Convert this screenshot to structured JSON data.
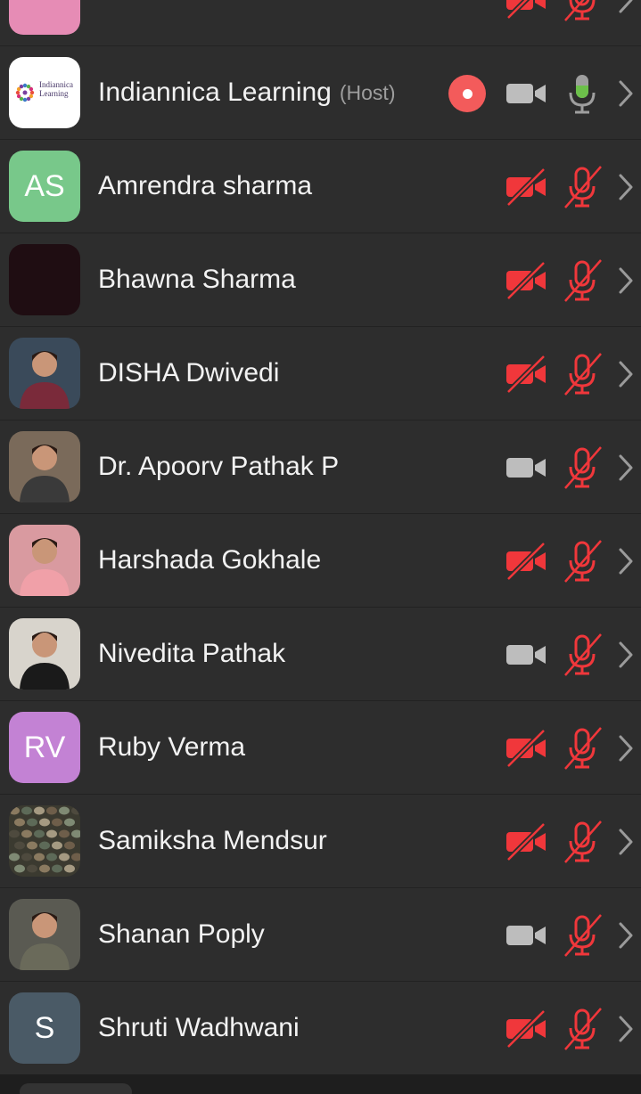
{
  "participants": [
    {
      "name": "",
      "initials": "",
      "avatar_type": "color",
      "avatar_color": "#e68cb5",
      "host_label": "",
      "recording": false,
      "video": "off",
      "audio": "muted"
    },
    {
      "name": "Indiannica Learning",
      "initials": "",
      "avatar_type": "logo",
      "logo_text": "Indiannica Learning",
      "host_label": "(Host)",
      "recording": true,
      "video": "on",
      "audio": "active"
    },
    {
      "name": "Amrendra sharma",
      "initials": "AS",
      "avatar_type": "initials",
      "avatar_color": "#78c88a",
      "host_label": "",
      "recording": false,
      "video": "off",
      "audio": "muted"
    },
    {
      "name": "Bhawna Sharma",
      "initials": "",
      "avatar_type": "color",
      "avatar_color": "#1f0d12",
      "host_label": "",
      "recording": false,
      "video": "off",
      "audio": "muted"
    },
    {
      "name": "DISHA Dwivedi",
      "initials": "",
      "avatar_type": "photo",
      "host_label": "",
      "recording": false,
      "video": "off",
      "audio": "muted"
    },
    {
      "name": "Dr. Apoorv Pathak P",
      "initials": "",
      "avatar_type": "photo",
      "host_label": "",
      "recording": false,
      "video": "on",
      "audio": "muted"
    },
    {
      "name": "Harshada Gokhale",
      "initials": "",
      "avatar_type": "photo",
      "host_label": "",
      "recording": false,
      "video": "off",
      "audio": "muted"
    },
    {
      "name": "Nivedita Pathak",
      "initials": "",
      "avatar_type": "photo",
      "host_label": "",
      "recording": false,
      "video": "on",
      "audio": "muted"
    },
    {
      "name": "Ruby Verma",
      "initials": "RV",
      "avatar_type": "initials",
      "avatar_color": "#c382d4",
      "host_label": "",
      "recording": false,
      "video": "off",
      "audio": "muted"
    },
    {
      "name": "Samiksha Mendsur",
      "initials": "",
      "avatar_type": "photo",
      "host_label": "",
      "recording": false,
      "video": "off",
      "audio": "muted"
    },
    {
      "name": "Shanan Poply",
      "initials": "",
      "avatar_type": "photo",
      "host_label": "",
      "recording": false,
      "video": "on",
      "audio": "muted"
    },
    {
      "name": "Shruti Wadhwani",
      "initials": "S",
      "avatar_type": "initials",
      "avatar_color": "#4a5a66",
      "host_label": "",
      "recording": false,
      "video": "off",
      "audio": "muted"
    }
  ],
  "icons": {
    "record": "record-icon",
    "video_on": "video-camera-icon",
    "video_off": "video-off-icon",
    "mic_active": "microphone-active-icon",
    "mic_muted": "microphone-muted-icon",
    "chevron": "chevron-right-icon"
  },
  "colors": {
    "background": "#2d2d2d",
    "text": "#f2f2f2",
    "muted_red": "#f0373b",
    "mic_active_green": "#6cc04a",
    "icon_gray": "#bdbdbd",
    "record_red": "#f35b5b",
    "host_label": "#9e9e9e"
  }
}
